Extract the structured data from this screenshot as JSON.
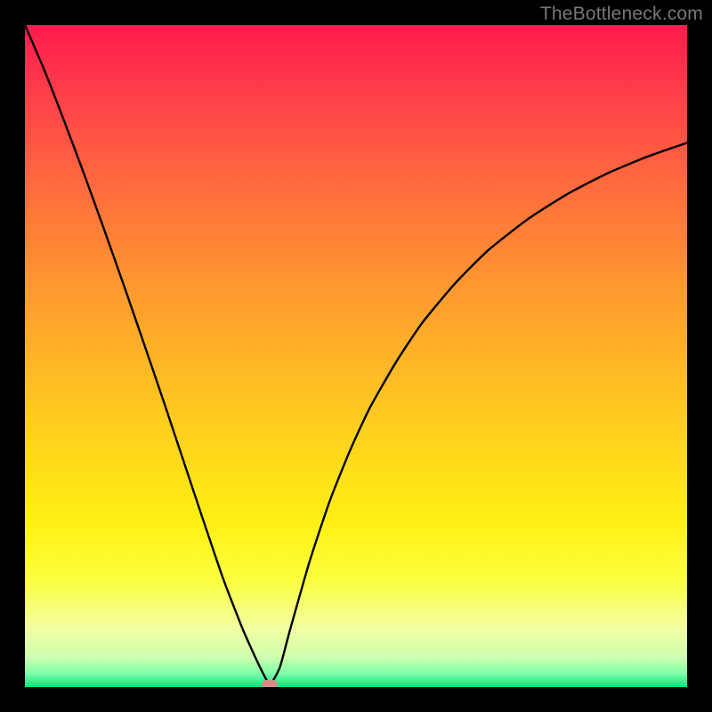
{
  "watermark": "TheBottleneck.com",
  "chart_data": {
    "type": "line",
    "title": "",
    "xlabel": "",
    "ylabel": "",
    "xlim": [
      0,
      1
    ],
    "ylim": [
      0,
      1
    ],
    "series": [
      {
        "name": "bottleneck-curve",
        "x": [
          0.0,
          0.03,
          0.06,
          0.09,
          0.12,
          0.15,
          0.18,
          0.21,
          0.24,
          0.27,
          0.3,
          0.33,
          0.355,
          0.37,
          0.385,
          0.4,
          0.43,
          0.46,
          0.49,
          0.52,
          0.56,
          0.6,
          0.65,
          0.7,
          0.76,
          0.82,
          0.88,
          0.94,
          1.0
        ],
        "y": [
          1.0,
          0.93,
          0.853,
          0.773,
          0.69,
          0.605,
          0.518,
          0.43,
          0.34,
          0.25,
          0.162,
          0.085,
          0.03,
          0.005,
          0.03,
          0.085,
          0.19,
          0.28,
          0.355,
          0.42,
          0.49,
          0.55,
          0.61,
          0.66,
          0.707,
          0.745,
          0.776,
          0.801,
          0.822
        ]
      }
    ],
    "minimum_marker": {
      "x": 0.37,
      "y": 0.0
    },
    "gradient_stops": [
      {
        "pos": 0.0,
        "color": "#ff1a4d"
      },
      {
        "pos": 0.5,
        "color": "#ffb020"
      },
      {
        "pos": 0.8,
        "color": "#fff020"
      },
      {
        "pos": 1.0,
        "color": "#00e87a"
      }
    ]
  }
}
